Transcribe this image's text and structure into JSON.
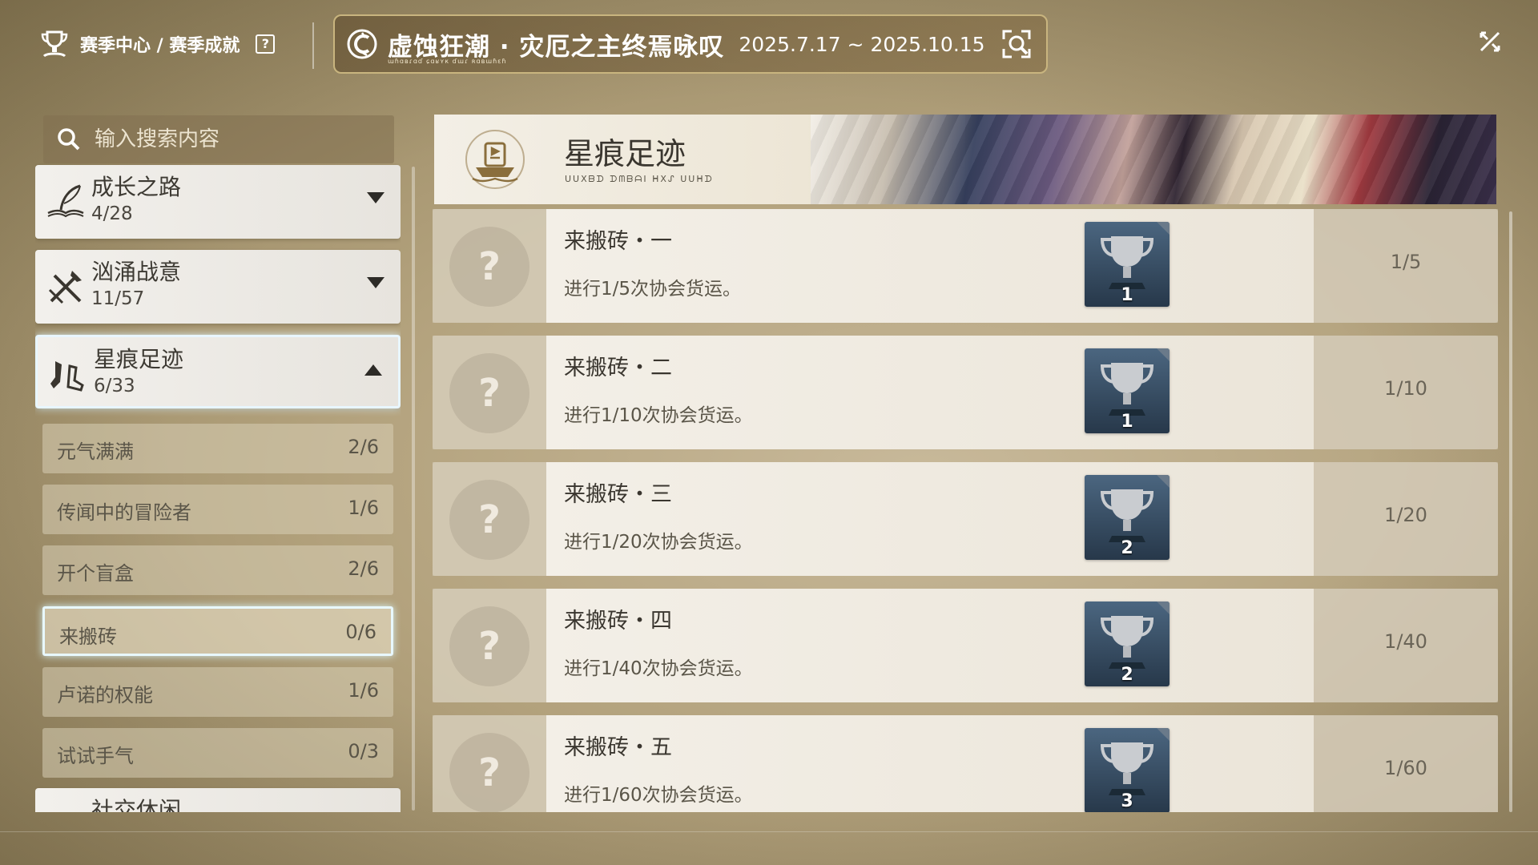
{
  "header": {
    "breadcrumb": "赛季中心 / 赛季成就",
    "help_icon": "?",
    "season_title": "虚蚀狂潮 · 灾厄之主终焉咏叹",
    "season_subtitle": "ɯɦɑʙɾɑɗ ɕɑʁʏк ɗɯɾ ʀɑʙɯɦɛɦ",
    "season_dates": "2025.7.17 ~ 2025.10.15"
  },
  "search": {
    "placeholder": "输入搜索内容"
  },
  "categories": [
    {
      "name": "成长之路",
      "count": "4/28"
    },
    {
      "name": "汹涌战意",
      "count": "11/57"
    },
    {
      "name": "星痕足迹",
      "count": "6/33"
    },
    {
      "name": "社交休闲"
    }
  ],
  "subcategories": [
    {
      "name": "元气满满",
      "count": "2/6"
    },
    {
      "name": "传闻中的冒险者",
      "count": "1/6"
    },
    {
      "name": "开个盲盒",
      "count": "2/6"
    },
    {
      "name": "来搬砖",
      "count": "0/6"
    },
    {
      "name": "卢诺的权能",
      "count": "1/6"
    },
    {
      "name": "试试手气",
      "count": "0/3"
    }
  ],
  "banner": {
    "title": "星痕足迹",
    "subtitle": "ᑌᑌXᗷᗪ ᗪᗰᗷᗩI ᕼXᔑ ᑌᑌᕼᗪ"
  },
  "achievements": [
    {
      "title": "来搬砖・一",
      "desc": "进行1/5次协会货运。",
      "trophy": "1",
      "progress": "1/5"
    },
    {
      "title": "来搬砖・二",
      "desc": "进行1/10次协会货运。",
      "trophy": "1",
      "progress": "1/10"
    },
    {
      "title": "来搬砖・三",
      "desc": "进行1/20次协会货运。",
      "trophy": "2",
      "progress": "1/20"
    },
    {
      "title": "来搬砖・四",
      "desc": "进行1/40次协会货运。",
      "trophy": "2",
      "progress": "1/40"
    },
    {
      "title": "来搬砖・五",
      "desc": "进行1/60次协会货运。",
      "trophy": "3",
      "progress": "1/60"
    }
  ],
  "locked_icon": "?"
}
